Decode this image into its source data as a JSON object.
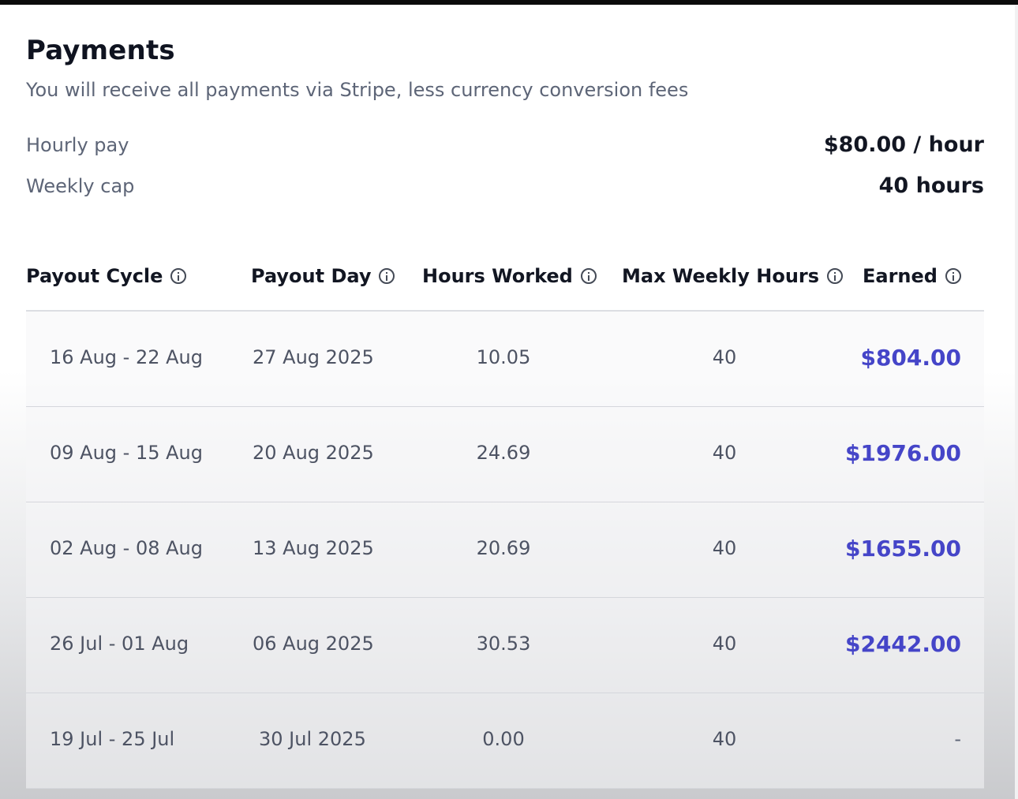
{
  "title": "Payments",
  "subtitle": "You will receive all payments via Stripe, less currency conversion fees",
  "summary": {
    "hourly_pay_label": "Hourly pay",
    "hourly_pay_value": "$80.00 / hour",
    "weekly_cap_label": "Weekly cap",
    "weekly_cap_value": "40 hours"
  },
  "table": {
    "headers": [
      "Payout Cycle",
      "Payout Day",
      "Hours Worked",
      "Max Weekly Hours",
      "Earned"
    ],
    "rows": [
      {
        "cycle": "16 Aug - 22 Aug",
        "day": "27 Aug 2025",
        "hours": "10.05",
        "max": "40",
        "earned": "$804.00"
      },
      {
        "cycle": "09 Aug - 15 Aug",
        "day": "20 Aug 2025",
        "hours": "24.69",
        "max": "40",
        "earned": "$1976.00"
      },
      {
        "cycle": "02 Aug - 08 Aug",
        "day": "13 Aug 2025",
        "hours": "20.69",
        "max": "40",
        "earned": "$1655.00"
      },
      {
        "cycle": "26 Jul - 01 Aug",
        "day": "06 Aug 2025",
        "hours": "30.53",
        "max": "40",
        "earned": "$2442.00"
      },
      {
        "cycle": "19 Jul - 25 Jul",
        "day": "30 Jul 2025",
        "hours": "0.00",
        "max": "40",
        "earned": "-"
      }
    ]
  },
  "colors": {
    "earned_accent": "#4545c8",
    "muted_text": "#5d6577"
  },
  "icons": {
    "header_info": "info-circle-icon"
  }
}
